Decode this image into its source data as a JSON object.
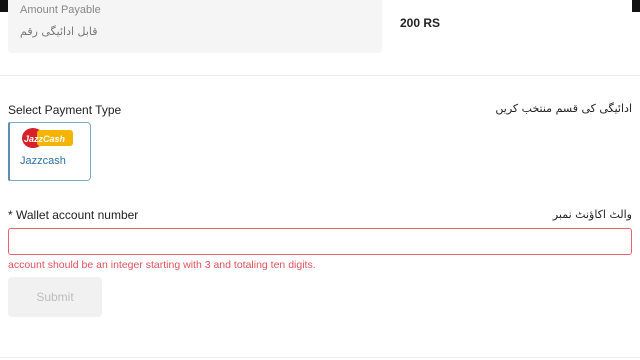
{
  "amount": {
    "label_en": "Amount Payable",
    "label_ur": "قابل ادائیگی رقم",
    "value": "200 RS"
  },
  "payment_type": {
    "label_en": "Select Payment Type",
    "label_ur": "ادائیگی کی قسم منتخب کریں",
    "options": [
      {
        "name": "Jazzcash",
        "logo_text": "JazzCash",
        "selected": true
      }
    ]
  },
  "wallet": {
    "label_en": "* Wallet account number",
    "label_ur": "والٹ اکاؤنٹ نمبر",
    "value": "",
    "placeholder": "",
    "error": "account should be an integer starting with 3 and totaling ten digits."
  },
  "submit": {
    "label": "Submit",
    "disabled": true
  },
  "colors": {
    "error": "#e0525d",
    "jazz_red": "#d6202a",
    "jazz_yellow": "#f4b400",
    "link_blue": "#2f6fa8"
  }
}
